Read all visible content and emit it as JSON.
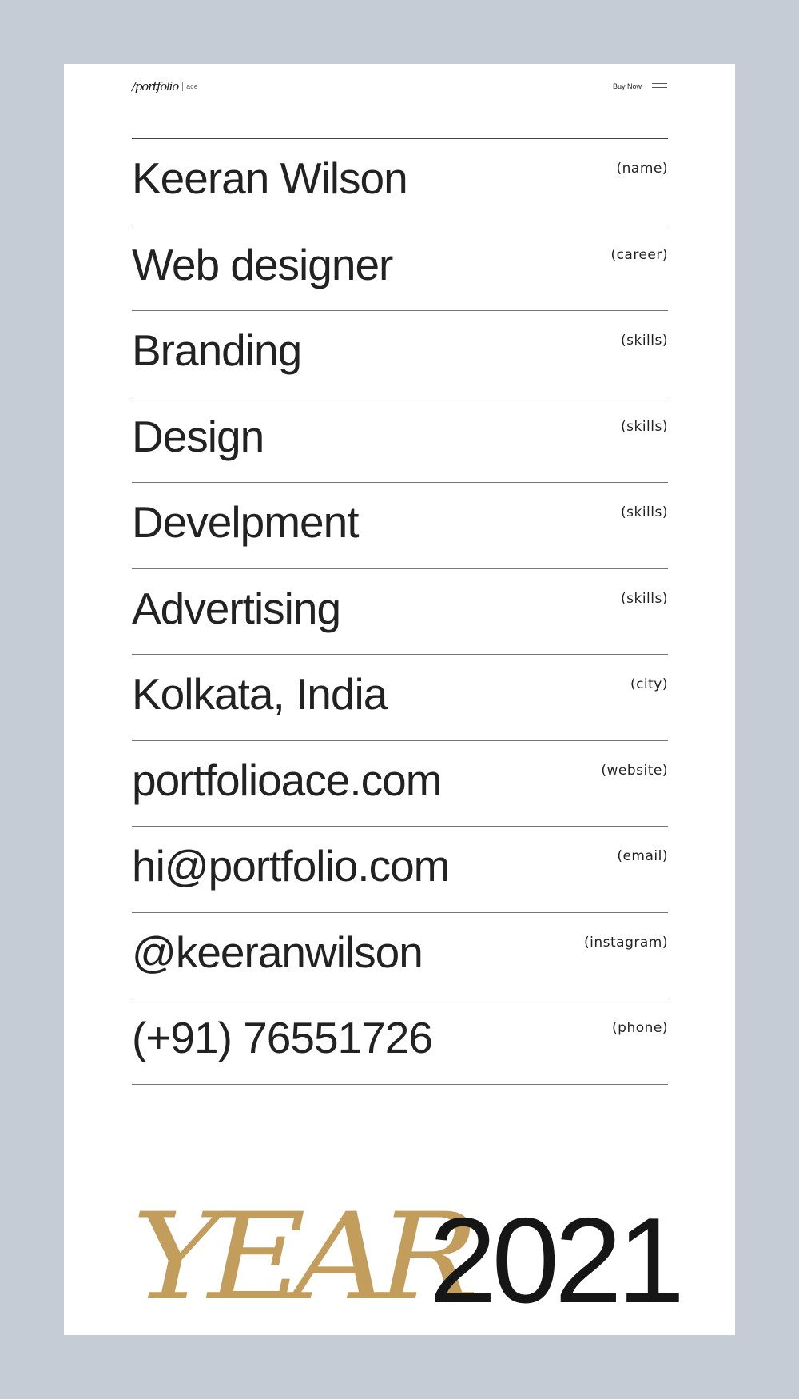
{
  "header": {
    "logo_word": "/portfolio",
    "logo_suffix": "ace",
    "buy_now_label": "Buy Now",
    "menu_icon": "hamburger-menu-icon"
  },
  "info_rows": [
    {
      "value": "Keeran Wilson",
      "label": "(name)"
    },
    {
      "value": "Web designer",
      "label": "(career)"
    },
    {
      "value": "Branding",
      "label": "(skills)"
    },
    {
      "value": "Design",
      "label": "(skills)"
    },
    {
      "value": "Develpment",
      "label": "(skills)"
    },
    {
      "value": "Advertising",
      "label": "(skills)"
    },
    {
      "value": "Kolkata, India",
      "label": "(city)"
    },
    {
      "value": "portfolioace.com",
      "label": "(website)"
    },
    {
      "value": "hi@portfolio.com",
      "label": "(email)"
    },
    {
      "value": "@keeranwilson",
      "label": "(instagram)"
    },
    {
      "value": "(+91) 76551726",
      "label": "(phone)"
    }
  ],
  "footer": {
    "year_word": "YEAR",
    "year_number": "2021"
  },
  "colors": {
    "page_background": "#c5ccd6",
    "card_background": "#ffffff",
    "text": "#222222",
    "accent_gold": "#c29d5c"
  }
}
